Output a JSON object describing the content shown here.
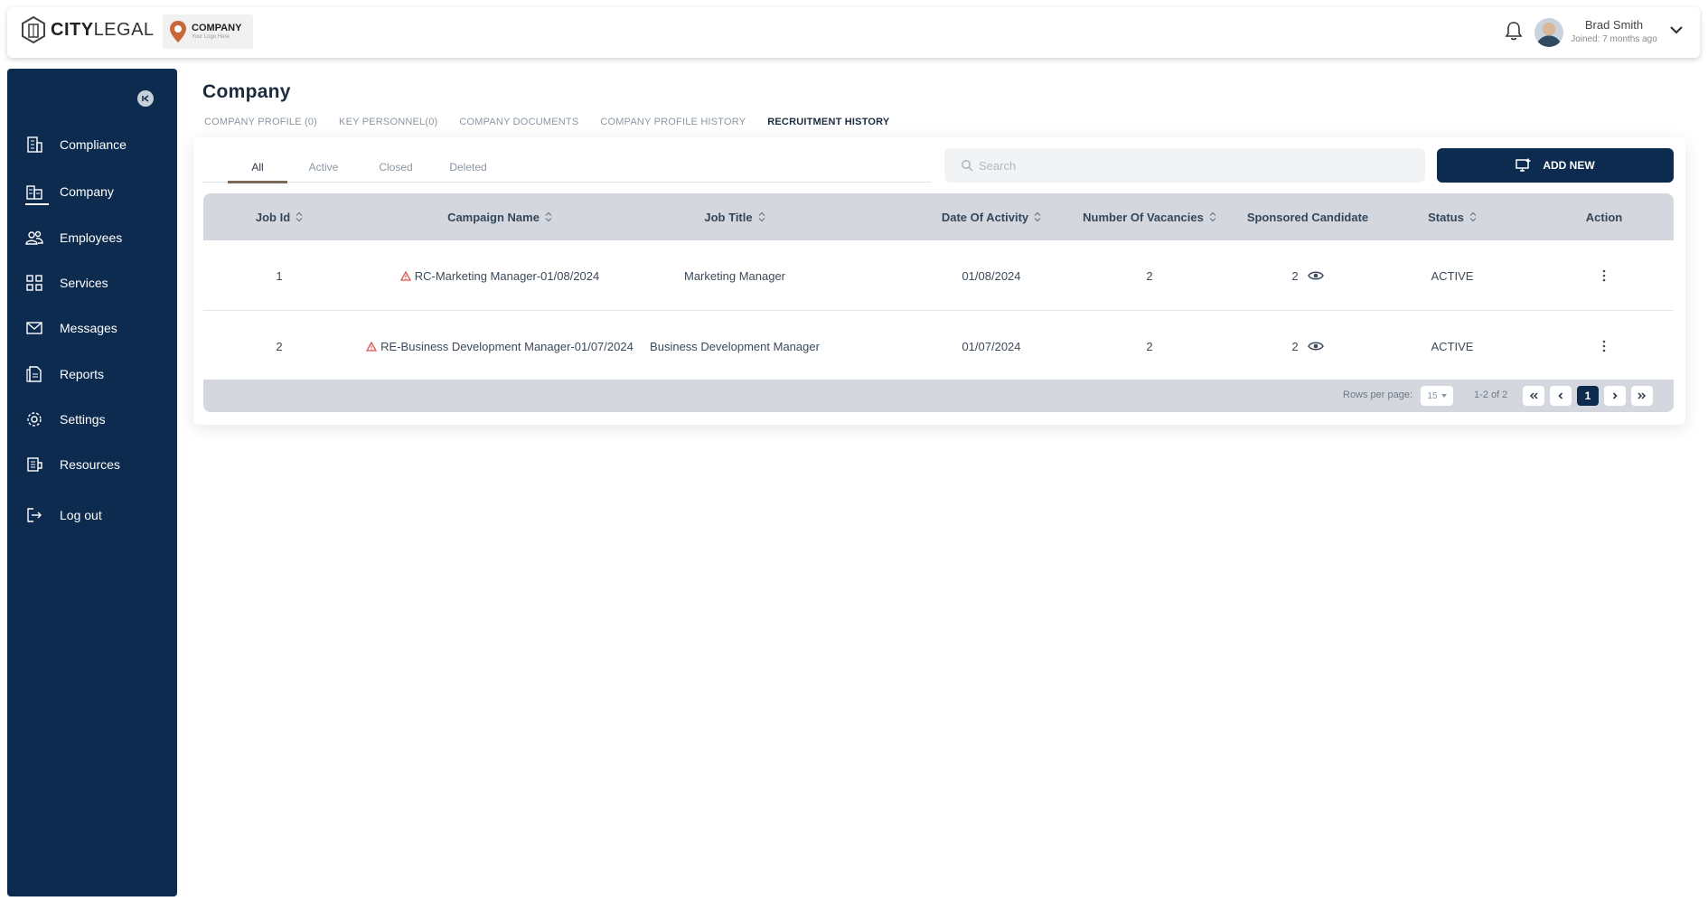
{
  "brand": {
    "name_bold": "CITY",
    "name_light": "LEGAL"
  },
  "company_logo": {
    "title": "COMPANY",
    "subtitle": "Your Logo Here"
  },
  "user": {
    "name": "Brad Smith",
    "joined": "Joined: 7 months ago"
  },
  "sidebar": {
    "items": [
      {
        "label": "Compliance",
        "icon": "compliance-icon"
      },
      {
        "label": "Company",
        "icon": "company-icon",
        "active": true
      },
      {
        "label": "Employees",
        "icon": "employees-icon"
      },
      {
        "label": "Services",
        "icon": "services-icon"
      },
      {
        "label": "Messages",
        "icon": "messages-icon"
      },
      {
        "label": "Reports",
        "icon": "reports-icon"
      },
      {
        "label": "Settings",
        "icon": "settings-icon"
      },
      {
        "label": "Resources",
        "icon": "resources-icon"
      },
      {
        "label": "Log out",
        "icon": "logout-icon"
      }
    ]
  },
  "page": {
    "title": "Company"
  },
  "tabs": [
    {
      "label": "COMPANY PROFILE (0)"
    },
    {
      "label": "KEY PERSONNEL(0)"
    },
    {
      "label": "COMPANY DOCUMENTS"
    },
    {
      "label": "COMPANY PROFILE HISTORY"
    },
    {
      "label": "RECRUITMENT HISTORY",
      "active": true
    }
  ],
  "filters": [
    {
      "label": "All",
      "active": true
    },
    {
      "label": "Active"
    },
    {
      "label": "Closed"
    },
    {
      "label": "Deleted"
    }
  ],
  "search": {
    "placeholder": "Search"
  },
  "add_button": {
    "label": "ADD NEW"
  },
  "table": {
    "columns": [
      "Job Id",
      "Campaign Name",
      "Job Title",
      "Date Of Activity",
      "Number Of Vacancies",
      "Sponsored Candidate",
      "Status",
      "Action"
    ],
    "rows": [
      {
        "job_id": "1",
        "campaign": "RC-Marketing Manager-01/08/2024",
        "job_title": "Marketing Manager",
        "date": "01/08/2024",
        "vacancies": "2",
        "sponsored": "2",
        "status": "ACTIVE"
      },
      {
        "job_id": "2",
        "campaign": "RE-Business Development Manager-01/07/2024",
        "job_title": "Business Development Manager",
        "date": "01/07/2024",
        "vacancies": "2",
        "sponsored": "2",
        "status": "ACTIVE"
      }
    ]
  },
  "pagination": {
    "rows_per_page_label": "Rows per page:",
    "rows_per_page": "15",
    "range": "1-2 of 2",
    "current_page": "1"
  },
  "colors": {
    "navy": "#0d2b4e",
    "warning": "#d9534f"
  }
}
